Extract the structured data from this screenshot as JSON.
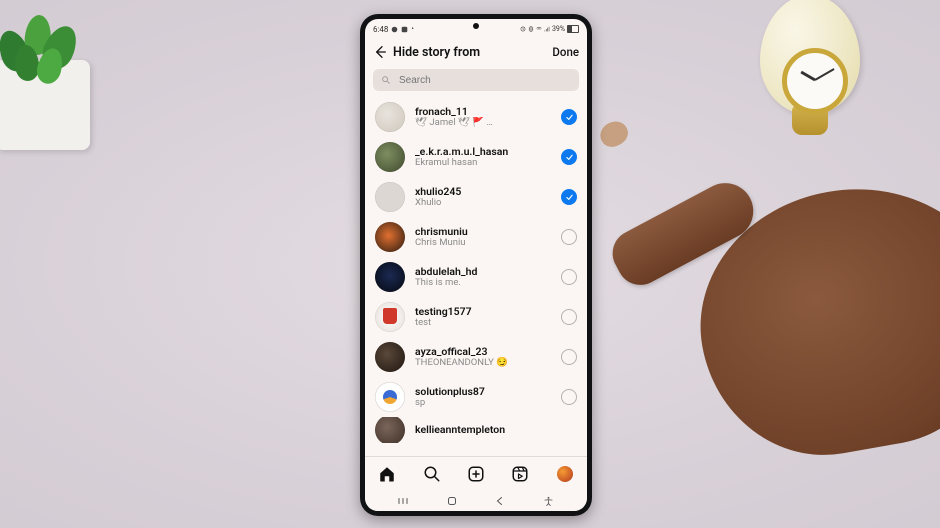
{
  "status_bar": {
    "time": "6:48",
    "battery_text": "39%"
  },
  "header": {
    "title": "Hide story from",
    "done": "Done"
  },
  "search": {
    "placeholder": "Search"
  },
  "users": [
    {
      "username": "fronach_11",
      "subtitle": "🕊 Jamel 🕊    🚩   …",
      "checked": true
    },
    {
      "username": "_e.k.r.a.m.u.l_hasan",
      "subtitle": "Ekramul hasan",
      "checked": true
    },
    {
      "username": "xhulio245",
      "subtitle": "Xhulio",
      "checked": true
    },
    {
      "username": "chrismuniu",
      "subtitle": "Chris Muniu",
      "checked": false
    },
    {
      "username": "abdulelah_hd",
      "subtitle": "This is me.",
      "checked": false
    },
    {
      "username": "testing1577",
      "subtitle": "test",
      "checked": false
    },
    {
      "username": "ayza_offical_23",
      "subtitle": "THEONEANDONLY 😏",
      "checked": false
    },
    {
      "username": "solutionplus87",
      "subtitle": "sp",
      "checked": false
    }
  ],
  "partial_user": {
    "username": "kellieanntempleton"
  },
  "bottom_nav": {
    "home": "home-icon",
    "search": "search-icon",
    "create": "add-post-icon",
    "reels": "reels-icon",
    "profile": "profile-avatar"
  },
  "android_nav": {
    "recent": "recent-apps",
    "home": "android-home",
    "back": "android-back",
    "access": "accessibility"
  }
}
